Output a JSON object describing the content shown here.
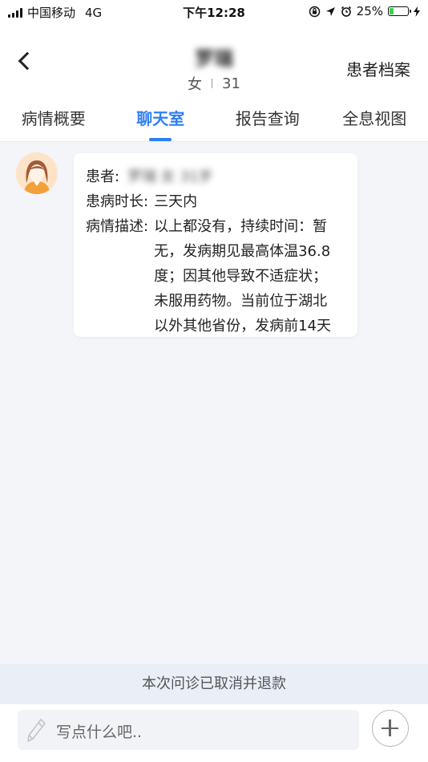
{
  "status_bar": {
    "carrier": "中国移动",
    "network": "4G",
    "time": "下午12:28",
    "battery_percent": "25%",
    "battery_level": 0.25
  },
  "header": {
    "patient_name": "罗瑞",
    "gender": "女",
    "age": "31",
    "archive_label": "患者档案"
  },
  "tabs": [
    {
      "label": "病情概要",
      "active": false
    },
    {
      "label": "聊天室",
      "active": true
    },
    {
      "label": "报告查询",
      "active": false
    },
    {
      "label": "全息视图",
      "active": false
    }
  ],
  "message": {
    "patient_label": "患者:",
    "patient_value": "罗瑞 女 31岁",
    "duration_label": "患病时长:",
    "duration_value": "三天内",
    "description_label": "病情描述:",
    "description_value": "以上都没有，持续时间：暂无，发病期见最高体温36.8度；因其他导致不适症状；未服用药物。当前位于湖北以外其他省份，发病前14天"
  },
  "notice": "本次问诊已取消并退款",
  "input": {
    "placeholder": "写点什么吧.."
  }
}
